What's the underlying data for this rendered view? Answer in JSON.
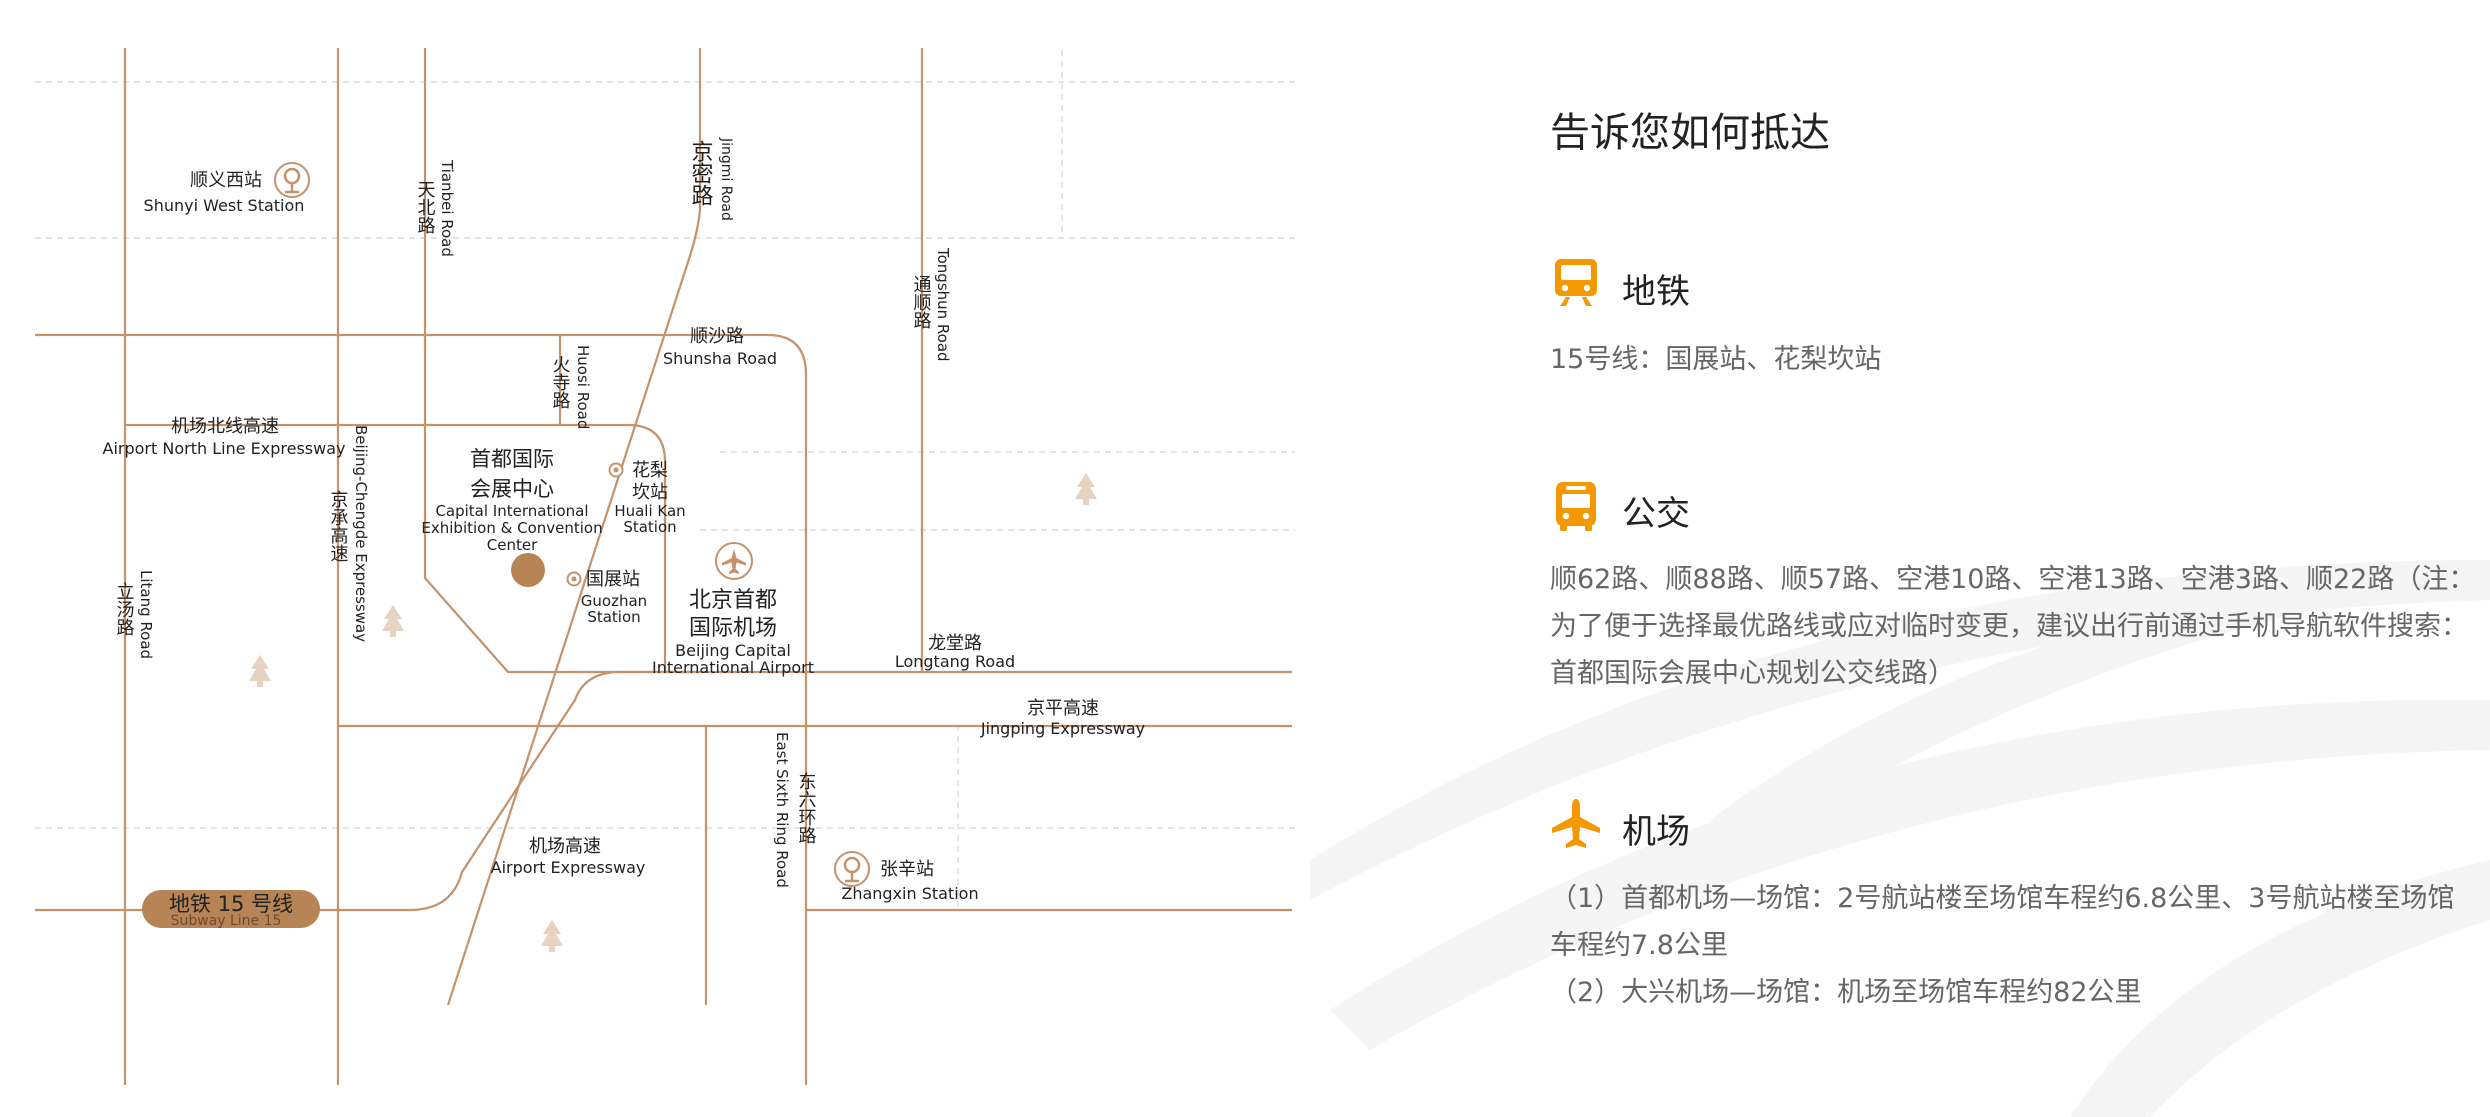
{
  "map": {
    "shunyi_west": {
      "cn": "顺义西站",
      "en": "Shunyi West Station"
    },
    "tianbei_road": {
      "cn": "天北路",
      "en": "Tianbei Road"
    },
    "jingmi_road": {
      "cn": "京密路",
      "en": "Jingmi Road"
    },
    "tongshun_road": {
      "cn": "通顺路",
      "en": "Tongshun Road"
    },
    "shunsha_road": {
      "cn": "顺沙路",
      "en": "Shunsha Road"
    },
    "huosi_road": {
      "cn": "火寺路",
      "en": "Huosi Road"
    },
    "airport_north": {
      "cn": "机场北线高速",
      "en": "Airport North Line Expressway"
    },
    "jingcheng": {
      "cn": "京承高速",
      "en": "Beijing-Chengde Expressway"
    },
    "venue": {
      "cn1": "首都国际",
      "cn2": "会展中心",
      "en1": "Capital International",
      "en2": "Exhibition & Convention",
      "en3": "Center"
    },
    "huali_kan": {
      "cn1": "花梨",
      "cn2": "坎站",
      "en1": "Huali Kan",
      "en2": "Station"
    },
    "guozhan": {
      "cn": "国展站",
      "en1": "Guozhan",
      "en2": "Station"
    },
    "capital_airport": {
      "cn1": "北京首都",
      "cn2": "国际机场",
      "en1": "Beijing Capital",
      "en2": "International Airport"
    },
    "litang_road": {
      "cn": "立汤路",
      "en": "Litang Road"
    },
    "longtang_road": {
      "cn": "龙堂路",
      "en": "Longtang Road"
    },
    "jingping": {
      "cn": "京平高速",
      "en": "Jingping Expressway"
    },
    "east_sixth": {
      "cn": "东六环路",
      "en": "East Sixth Ring Road"
    },
    "airport_expressway": {
      "cn": "机场高速",
      "en": "Airport Expressway"
    },
    "zhangxin": {
      "cn": "张辛站",
      "en": "Zhangxin Station"
    },
    "subway_line": {
      "cn": "地铁 15 号线",
      "en": "Subway Line 15"
    }
  },
  "panel": {
    "title": "告诉您如何抵达",
    "sections": [
      {
        "icon": "subway-icon",
        "title": "地铁",
        "lines": [
          "15号线：国展站、花梨坎站"
        ]
      },
      {
        "icon": "bus-icon",
        "title": "公交",
        "lines": [
          "顺62路、顺88路、顺57路、空港10路、空港13路、空港3路、顺22路（注：为了便于选择最优路线或应对临时变更，建议出行前通过手机导航软件搜索：首都国际会展中心规划公交线路）"
        ]
      },
      {
        "icon": "airplane-icon",
        "title": "机场",
        "lines": [
          "（1）首都机场—场馆：2号航站楼至场馆车程约6.8公里、3号航站楼至场馆车程约7.8公里",
          "（2）大兴机场—场馆：机场至场馆车程约82公里"
        ]
      }
    ]
  },
  "colors": {
    "road": "#c4926b",
    "accent": "#f39800",
    "venue": "#b78456",
    "text": "#666666"
  }
}
